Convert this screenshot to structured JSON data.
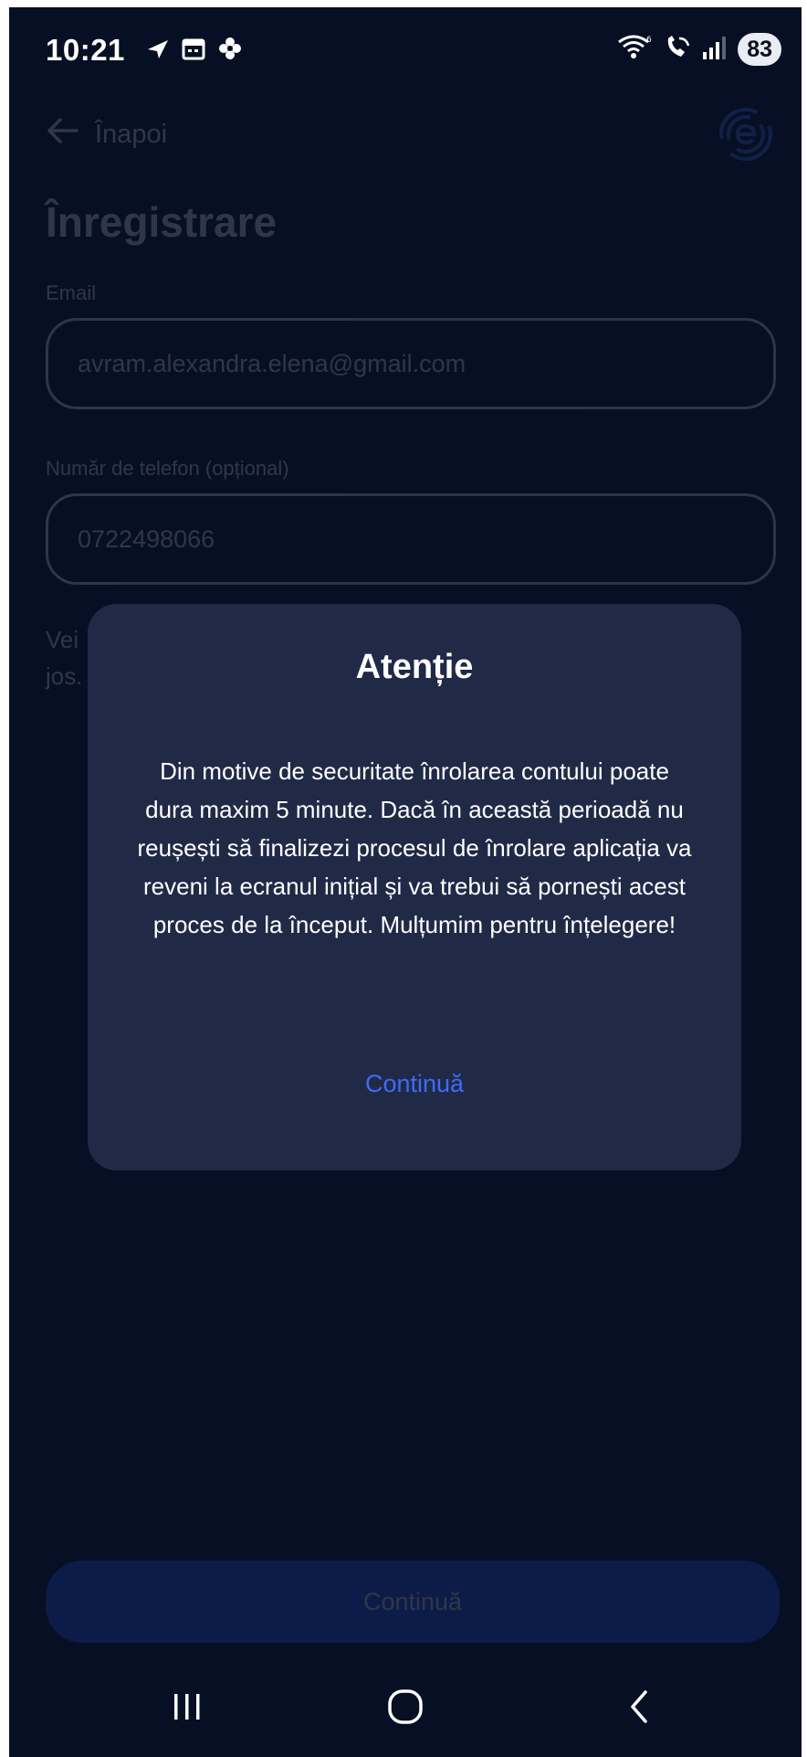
{
  "status_bar": {
    "time": "10:21",
    "battery": "83",
    "icons": [
      "navigation-icon",
      "calendar-icon",
      "pinwheel-icon",
      "wifi-icon",
      "wifi-calling-icon",
      "signal-icon"
    ]
  },
  "header": {
    "back_label": "Înapoi",
    "logo_icon": "brand-logo-icon"
  },
  "page": {
    "title": "Înregistrare",
    "email": {
      "label": "Email",
      "value": "avram.alexandra.elena@gmail.com"
    },
    "phone": {
      "label": "Număr de telefon (opțional)",
      "value": "0722498066"
    },
    "info_text_visible": "Vei\njos.",
    "continue_button": "Continuă"
  },
  "modal": {
    "title": "Atenție",
    "body": "Din motive de securitate înrolarea contului poate dura maxim 5 minute. Dacă în această perioadă nu reușești să finalizezi procesul de înrolare aplicația va reveni la ecranul inițial și va trebui să pornești acest proces de la început. Mulțumim pentru înțelegere!",
    "action": "Continuă"
  },
  "colors": {
    "background": "#070f25",
    "modal": "#202a47",
    "accent": "#3f6bf5"
  }
}
